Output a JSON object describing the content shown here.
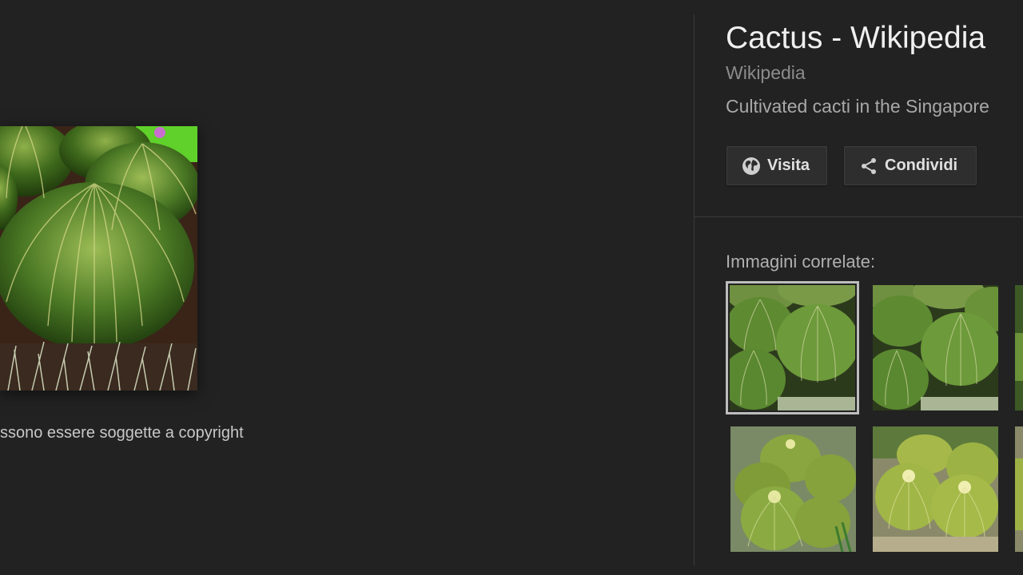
{
  "viewer": {
    "copyright_note": "ssono essere soggette a copyright"
  },
  "panel": {
    "title": "Cactus - Wikipedia",
    "source": "Wikipedia",
    "description": "Cultivated cacti in the Singapore",
    "buttons": {
      "visit_label": "Visita",
      "share_label": "Condividi"
    },
    "related_label": "Immagini correlate:",
    "related_images": [
      {
        "name": "golden barrel cacti",
        "selected": true
      },
      {
        "name": "golden barrel cacti",
        "selected": false
      },
      {
        "name": "cactus",
        "selected": false
      },
      {
        "name": "golden barrel cacti cluster",
        "selected": false
      },
      {
        "name": "golden barrel cacti yellow",
        "selected": false
      },
      {
        "name": "cactus",
        "selected": false
      }
    ]
  },
  "icons": {
    "visit": "globe-icon",
    "share": "share-icon"
  },
  "colors": {
    "background": "#222222",
    "button_bg": "#2e2e2e",
    "text_primary": "#f0f0f0",
    "text_secondary": "#8c8c8c",
    "selected_outline": "#bdbdbd"
  }
}
